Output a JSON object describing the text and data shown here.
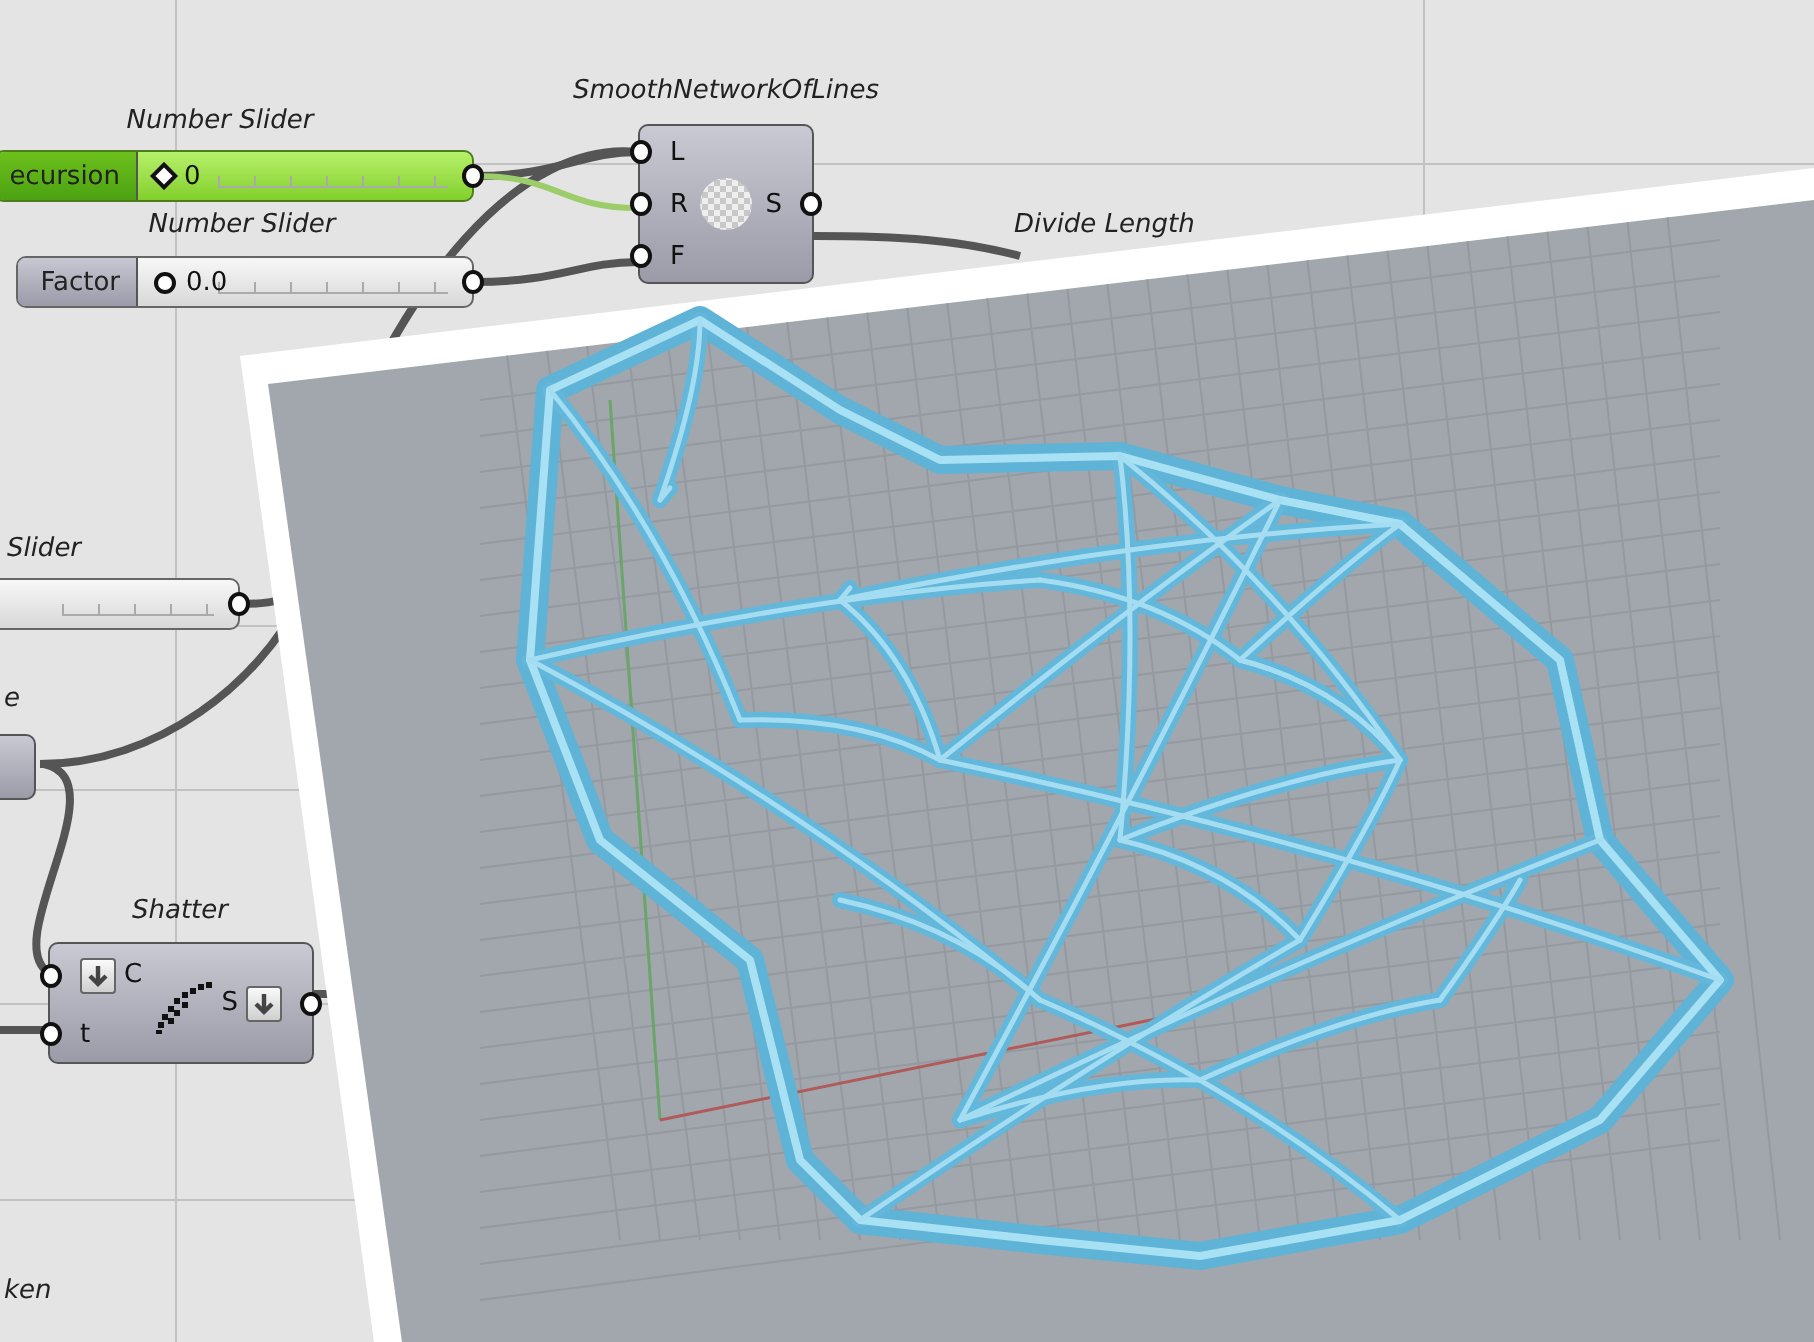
{
  "canvas": {
    "sliders": [
      {
        "title": "Number Slider",
        "label": "ecursion",
        "value": "0",
        "kind": "integer",
        "selected": true
      },
      {
        "title": "Number Slider",
        "label": "Factor",
        "value": "0.0",
        "kind": "float",
        "selected": false
      },
      {
        "title": "Slider",
        "kind": "plain",
        "selected": false
      }
    ],
    "components": [
      {
        "title": "SmoothNetworkOfLines",
        "kind": "smooth",
        "inputs": [
          "L",
          "R",
          "F"
        ],
        "outputs": [
          "S"
        ]
      },
      {
        "title": "e",
        "kind": "stub"
      },
      {
        "title": "Shatter",
        "kind": "shatter",
        "inputs": [
          "C",
          "t"
        ],
        "outputs": [
          "S"
        ]
      }
    ],
    "labels": [
      "Divide Length",
      "ken"
    ]
  }
}
